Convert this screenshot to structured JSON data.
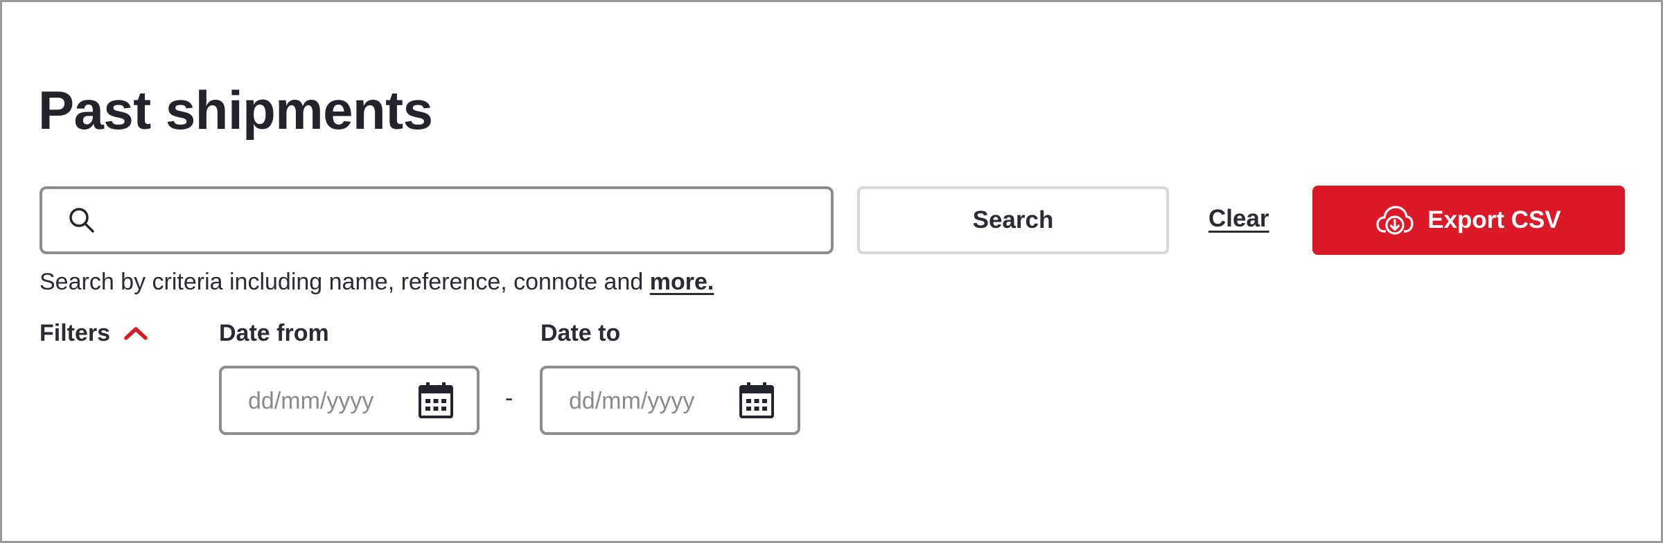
{
  "page": {
    "title": "Past shipments"
  },
  "search": {
    "value": "",
    "placeholder": "",
    "button_label": "Search",
    "clear_label": "Clear",
    "helper_text": "Search by criteria including name, reference, connote and ",
    "helper_link": "more."
  },
  "export": {
    "label": "Export CSV",
    "icon": "cloud-download-icon"
  },
  "filters": {
    "label": "Filters",
    "expanded": true,
    "date_from": {
      "label": "Date from",
      "placeholder": "dd/mm/yyyy",
      "value": ""
    },
    "separator": "-",
    "date_to": {
      "label": "Date to",
      "placeholder": "dd/mm/yyyy",
      "value": ""
    }
  },
  "colors": {
    "accent": "#dc1928",
    "text": "#23232b",
    "border": "#8c8c8c",
    "button_border": "#d7d7d7"
  }
}
